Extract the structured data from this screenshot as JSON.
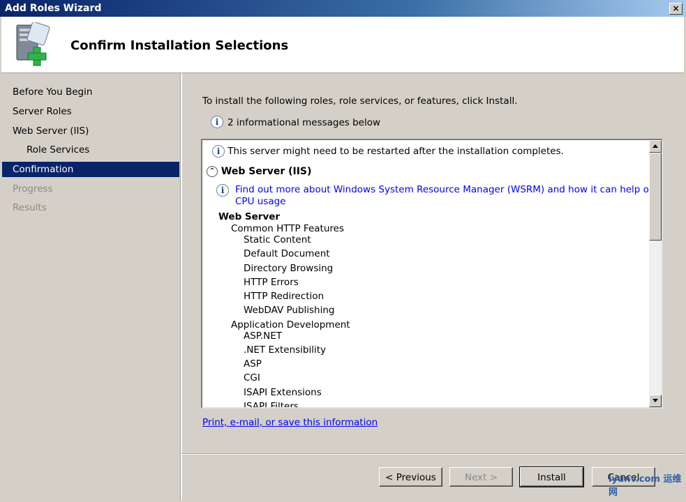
{
  "window": {
    "title": "Add Roles Wizard",
    "close_label": "×"
  },
  "header": {
    "title": "Confirm Installation Selections"
  },
  "nav": [
    {
      "label": "Before You Begin",
      "state": "normal"
    },
    {
      "label": "Server Roles",
      "state": "normal"
    },
    {
      "label": "Web Server (IIS)",
      "state": "normal"
    },
    {
      "label": "Role Services",
      "state": "normal"
    },
    {
      "label": "Confirmation",
      "state": "selected"
    },
    {
      "label": "Progress",
      "state": "disabled"
    },
    {
      "label": "Results",
      "state": "disabled"
    }
  ],
  "main": {
    "intro": "To install the following roles, role services, or features, click Install.",
    "info_count": "2 informational messages below",
    "list": {
      "restart_msg": "This server might need to be restarted after the installation completes.",
      "section_title": "Web Server (IIS)",
      "wsrm_link_line1": "Find out more about Windows System Resource Manager (WSRM) and how it can help optimize",
      "wsrm_link_line2": "CPU usage",
      "group_title": "Web Server",
      "sub_common": "Common HTTP Features",
      "items_common": [
        "Static Content",
        "Default Document",
        "Directory Browsing",
        "HTTP Errors",
        "HTTP Redirection",
        "WebDAV Publishing"
      ],
      "sub_appdev": "Application Development",
      "items_appdev": [
        "ASP.NET",
        ".NET Extensibility",
        "ASP",
        "CGI",
        "ISAPI Extensions",
        "ISAPI Filters"
      ]
    },
    "print_link": "Print, e-mail, or save this information"
  },
  "buttons": {
    "previous": "< Previous",
    "next": "Next >",
    "install": "Install",
    "cancel": "Cancel"
  },
  "watermark": "iyunv.com 运维网",
  "icons": {
    "info": "info-icon",
    "collapse": "chevron-up-circle-icon",
    "server": "server-add-icon"
  }
}
